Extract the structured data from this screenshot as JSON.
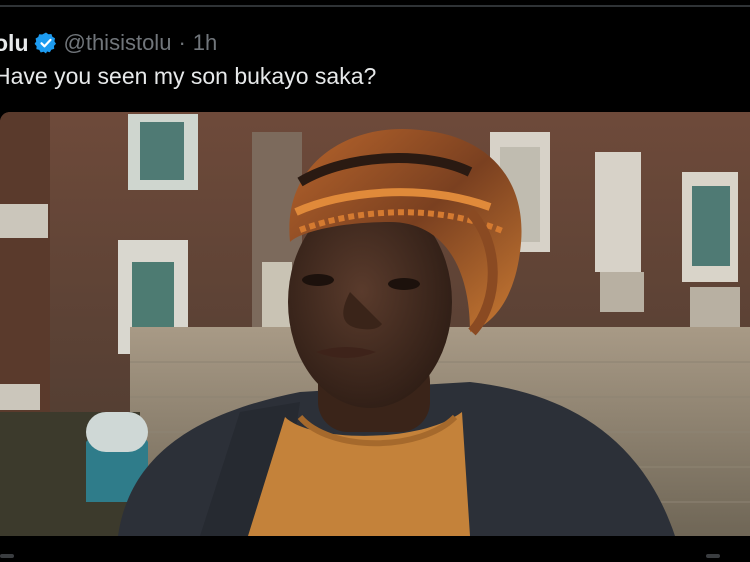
{
  "tweet": {
    "display_name": "olu",
    "handle": "@thisistolu",
    "separator": "·",
    "time": "1h",
    "text": "Have you seen my son bukayo saka?",
    "verified_icon": "verified-badge-icon"
  },
  "media": {
    "alt_subject": "photo",
    "colors": {
      "brick": "#8a5a44",
      "sky": "#c9cfc4",
      "scarf_orange": "#c8692a",
      "sweater": "#c98a3a",
      "jacket": "#2c3038",
      "skin": "#4a3024"
    }
  },
  "colors": {
    "background": "#000000",
    "text_primary": "#e7e9ea",
    "text_secondary": "#71767b",
    "verified_blue": "#1d9bf0"
  }
}
